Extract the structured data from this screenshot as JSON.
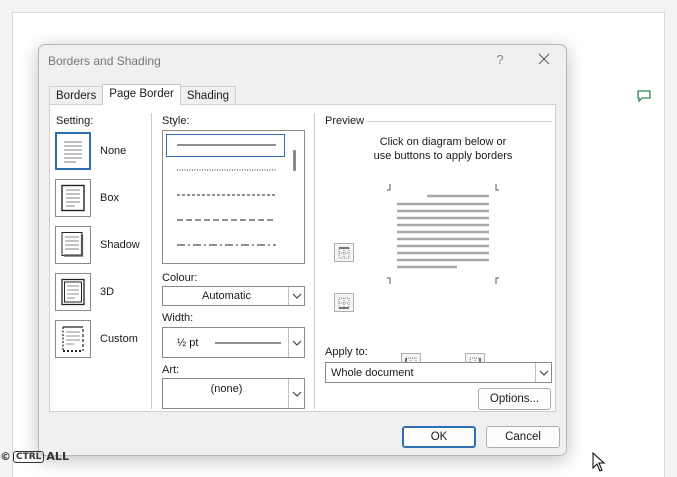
{
  "dialog": {
    "title": "Borders and Shading",
    "help": "?",
    "tabs": [
      {
        "label": "Borders",
        "key": "B"
      },
      {
        "label": "Page Border",
        "key": "P"
      },
      {
        "label": "Shading",
        "key": "S"
      }
    ],
    "active_tab": "Page Border"
  },
  "setting": {
    "label": "Setting:",
    "items": [
      {
        "label": "None",
        "selected": true
      },
      {
        "label": "Box",
        "selected": false
      },
      {
        "label": "Shadow",
        "selected": false
      },
      {
        "label": "3D",
        "selected": false
      },
      {
        "label": "Custom",
        "selected": false
      }
    ]
  },
  "style": {
    "label": "Style:",
    "lines": [
      "solid",
      "dotted",
      "dashed-small",
      "dashed",
      "dash-dot"
    ]
  },
  "colour": {
    "label": "Colour:",
    "value": "Automatic"
  },
  "width": {
    "label": "Width:",
    "value": "½ pt"
  },
  "art": {
    "label": "Art:",
    "value": "(none)"
  },
  "preview": {
    "label": "Preview",
    "hint_line1": "Click on diagram below or",
    "hint_line2": "use buttons to apply borders"
  },
  "apply": {
    "label": "Apply to:",
    "value": "Whole document"
  },
  "buttons": {
    "options": "Options...",
    "ok": "OK",
    "cancel": "Cancel"
  },
  "watermark": {
    "brand_box": "CTRL",
    "brand_text": "ALL",
    "symbol": "©"
  },
  "colors": {
    "accent": "#2f6db5",
    "dialog_bg": "#f0f0f0",
    "comment_green": "#2e8b57"
  }
}
